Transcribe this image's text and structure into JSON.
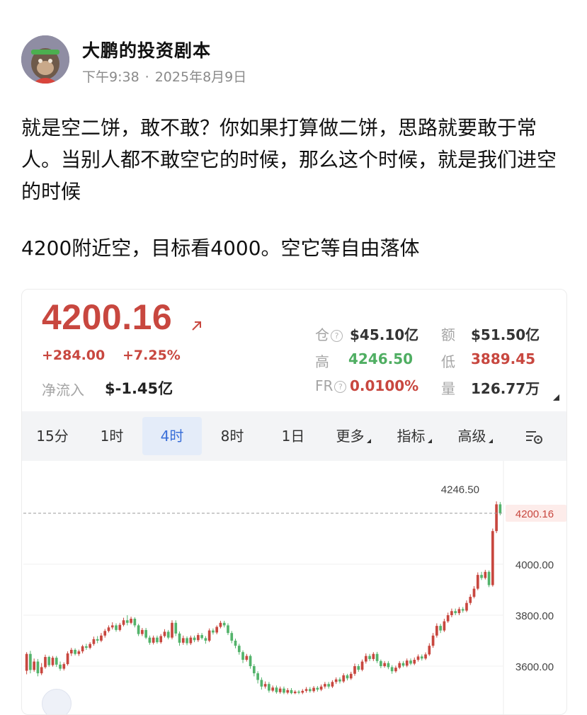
{
  "post": {
    "author": "大鹏的投资剧本",
    "time": "下午9:38",
    "dot": "·",
    "date": "2025年8月9日",
    "paragraphs": [
      "就是空二饼，敢不敢？你如果打算做二饼，思路就要敢于常人。当别人都不敢空它的时候，那么这个时候，就是我们进空的时候",
      "4200附近空，目标看4000。空它等自由落体"
    ]
  },
  "ticker": {
    "price": "4200.16",
    "change_abs": "+284.00",
    "change_pct": "+7.25%",
    "netflow_label": "净流入",
    "netflow_value": "$-1.45亿",
    "stats": {
      "position_label": "仓",
      "position_value": "$45.10亿",
      "amount_label": "额",
      "amount_value": "$51.50亿",
      "high_label": "高",
      "high_value": "4246.50",
      "low_label": "低",
      "low_value": "3889.45",
      "fr_label": "FR",
      "fr_value": "0.0100%",
      "volume_label": "量",
      "volume_value": "126.77万"
    },
    "help_glyph": "?"
  },
  "tabs": [
    {
      "label": "15分",
      "active": false
    },
    {
      "label": "1时",
      "active": false
    },
    {
      "label": "4时",
      "active": true
    },
    {
      "label": "8时",
      "active": false
    },
    {
      "label": "1日",
      "active": false
    },
    {
      "label": "更多",
      "active": false,
      "caret": true
    },
    {
      "label": "指标",
      "active": false,
      "caret": true
    },
    {
      "label": "高级",
      "active": false,
      "caret": true
    }
  ],
  "icons": {
    "trend": "arrow-up-right-icon",
    "settings": "chart-settings-icon",
    "float": "expand-icon"
  },
  "colors": {
    "up": "#c8473f",
    "down": "#53b36b",
    "accent": "#3a6fd8"
  },
  "chart_data": {
    "type": "candlestick",
    "interval": "4时",
    "y_ticks": [
      "4000.00",
      "3800.00",
      "3600.00"
    ],
    "ylim": [
      3490,
      4290
    ],
    "high_marker": "4246.50",
    "last_price": "4200.16",
    "candles": [
      [
        3582,
        3648,
        3568,
        3655
      ],
      [
        3648,
        3585,
        3572,
        3660
      ],
      [
        3585,
        3618,
        3578,
        3630
      ],
      [
        3618,
        3572,
        3560,
        3628
      ],
      [
        3572,
        3596,
        3565,
        3612
      ],
      [
        3596,
        3636,
        3590,
        3645
      ],
      [
        3636,
        3604,
        3597,
        3641
      ],
      [
        3604,
        3633,
        3598,
        3640
      ],
      [
        3633,
        3606,
        3597,
        3640
      ],
      [
        3606,
        3590,
        3582,
        3618
      ],
      [
        3590,
        3608,
        3583,
        3615
      ],
      [
        3608,
        3650,
        3602,
        3658
      ],
      [
        3650,
        3664,
        3640,
        3672
      ],
      [
        3664,
        3648,
        3642,
        3670
      ],
      [
        3648,
        3658,
        3640,
        3665
      ],
      [
        3658,
        3678,
        3650,
        3684
      ],
      [
        3678,
        3672,
        3664,
        3688
      ],
      [
        3672,
        3687,
        3666,
        3694
      ],
      [
        3687,
        3706,
        3680,
        3716
      ],
      [
        3706,
        3700,
        3690,
        3718
      ],
      [
        3700,
        3720,
        3694,
        3730
      ],
      [
        3720,
        3738,
        3712,
        3746
      ],
      [
        3738,
        3752,
        3732,
        3760
      ],
      [
        3752,
        3760,
        3744,
        3772
      ],
      [
        3760,
        3742,
        3735,
        3768
      ],
      [
        3742,
        3762,
        3736,
        3770
      ],
      [
        3762,
        3780,
        3756,
        3790
      ],
      [
        3780,
        3770,
        3760,
        3800
      ],
      [
        3770,
        3786,
        3764,
        3794
      ],
      [
        3786,
        3760,
        3752,
        3792
      ],
      [
        3760,
        3726,
        3718,
        3766
      ],
      [
        3726,
        3742,
        3718,
        3750
      ],
      [
        3742,
        3712,
        3706,
        3750
      ],
      [
        3712,
        3692,
        3684,
        3720
      ],
      [
        3692,
        3712,
        3685,
        3720
      ],
      [
        3712,
        3694,
        3688,
        3720
      ],
      [
        3694,
        3718,
        3688,
        3726
      ],
      [
        3718,
        3735,
        3712,
        3745
      ],
      [
        3735,
        3712,
        3705,
        3742
      ],
      [
        3712,
        3770,
        3705,
        3780
      ],
      [
        3770,
        3728,
        3718,
        3780
      ],
      [
        3728,
        3692,
        3680,
        3736
      ],
      [
        3692,
        3710,
        3684,
        3720
      ],
      [
        3710,
        3690,
        3682,
        3717
      ],
      [
        3690,
        3712,
        3683,
        3720
      ],
      [
        3712,
        3702,
        3694,
        3720
      ],
      [
        3702,
        3722,
        3695,
        3730
      ],
      [
        3722,
        3710,
        3704,
        3730
      ],
      [
        3710,
        3700,
        3688,
        3718
      ],
      [
        3700,
        3740,
        3694,
        3748
      ],
      [
        3740,
        3732,
        3724,
        3748
      ],
      [
        3732,
        3754,
        3725,
        3760
      ],
      [
        3754,
        3770,
        3748,
        3778
      ],
      [
        3770,
        3760,
        3752,
        3778
      ],
      [
        3760,
        3730,
        3722,
        3768
      ],
      [
        3730,
        3700,
        3690,
        3738
      ],
      [
        3700,
        3680,
        3670,
        3708
      ],
      [
        3680,
        3655,
        3645,
        3688
      ],
      [
        3655,
        3625,
        3612,
        3662
      ],
      [
        3625,
        3640,
        3618,
        3648
      ],
      [
        3640,
        3600,
        3590,
        3646
      ],
      [
        3600,
        3572,
        3560,
        3608
      ],
      [
        3572,
        3546,
        3532,
        3580
      ],
      [
        3546,
        3520,
        3508,
        3556
      ],
      [
        3520,
        3530,
        3512,
        3540
      ],
      [
        3530,
        3504,
        3496,
        3538
      ],
      [
        3504,
        3516,
        3498,
        3524
      ],
      [
        3516,
        3498,
        3492,
        3524
      ],
      [
        3498,
        3512,
        3492,
        3520
      ],
      [
        3512,
        3496,
        3490,
        3520
      ],
      [
        3496,
        3506,
        3490,
        3514
      ],
      [
        3506,
        3494,
        3490,
        3514
      ],
      [
        3494,
        3500,
        3490,
        3506
      ],
      [
        3500,
        3496,
        3490,
        3506
      ],
      [
        3496,
        3503,
        3490,
        3510
      ],
      [
        3503,
        3510,
        3496,
        3518
      ],
      [
        3510,
        3502,
        3496,
        3518
      ],
      [
        3502,
        3515,
        3496,
        3522
      ],
      [
        3515,
        3508,
        3500,
        3522
      ],
      [
        3508,
        3520,
        3502,
        3528
      ],
      [
        3520,
        3530,
        3512,
        3538
      ],
      [
        3530,
        3520,
        3512,
        3538
      ],
      [
        3520,
        3538,
        3514,
        3545
      ],
      [
        3538,
        3548,
        3530,
        3556
      ],
      [
        3548,
        3540,
        3532,
        3556
      ],
      [
        3540,
        3564,
        3534,
        3572
      ],
      [
        3564,
        3552,
        3544,
        3570
      ],
      [
        3552,
        3570,
        3546,
        3578
      ],
      [
        3570,
        3600,
        3562,
        3610
      ],
      [
        3600,
        3586,
        3578,
        3608
      ],
      [
        3586,
        3618,
        3580,
        3626
      ],
      [
        3618,
        3640,
        3610,
        3650
      ],
      [
        3640,
        3628,
        3620,
        3648
      ],
      [
        3628,
        3648,
        3620,
        3655
      ],
      [
        3648,
        3620,
        3612,
        3656
      ],
      [
        3620,
        3600,
        3592,
        3626
      ],
      [
        3600,
        3612,
        3594,
        3620
      ],
      [
        3612,
        3596,
        3588,
        3620
      ],
      [
        3596,
        3580,
        3570,
        3604
      ],
      [
        3580,
        3594,
        3574,
        3602
      ],
      [
        3594,
        3612,
        3588,
        3620
      ],
      [
        3612,
        3602,
        3596,
        3620
      ],
      [
        3602,
        3622,
        3596,
        3630
      ],
      [
        3622,
        3610,
        3604,
        3630
      ],
      [
        3610,
        3625,
        3604,
        3634
      ],
      [
        3625,
        3638,
        3618,
        3646
      ],
      [
        3638,
        3630,
        3622,
        3646
      ],
      [
        3630,
        3646,
        3624,
        3654
      ],
      [
        3646,
        3680,
        3640,
        3690
      ],
      [
        3680,
        3720,
        3672,
        3730
      ],
      [
        3720,
        3758,
        3712,
        3768
      ],
      [
        3758,
        3740,
        3730,
        3766
      ],
      [
        3740,
        3776,
        3734,
        3786
      ],
      [
        3776,
        3800,
        3770,
        3810
      ],
      [
        3800,
        3816,
        3792,
        3826
      ],
      [
        3816,
        3808,
        3800,
        3826
      ],
      [
        3808,
        3824,
        3800,
        3832
      ],
      [
        3824,
        3818,
        3810,
        3832
      ],
      [
        3818,
        3848,
        3812,
        3858
      ],
      [
        3848,
        3872,
        3840,
        3882
      ],
      [
        3872,
        3904,
        3866,
        3914
      ],
      [
        3904,
        3958,
        3898,
        3968
      ],
      [
        3958,
        3946,
        3938,
        3970
      ],
      [
        3946,
        3970,
        3940,
        3978
      ],
      [
        3970,
        3918,
        3910,
        3976
      ],
      [
        3918,
        4130,
        3912,
        4140
      ],
      [
        4130,
        4235,
        4122,
        4246.5
      ],
      [
        4235,
        4200.16,
        4192,
        4244
      ]
    ]
  }
}
